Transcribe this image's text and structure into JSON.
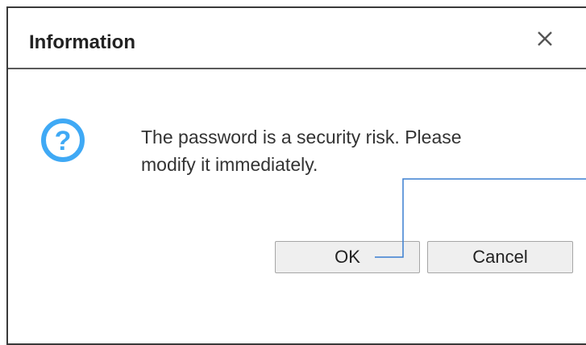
{
  "dialog": {
    "title": "Information",
    "message_line1": "The password is a security risk. Please",
    "message_line2": "modify it immediately.",
    "ok_label": "OK",
    "cancel_label": "Cancel"
  },
  "icons": {
    "dialog_icon": "question-circle-icon",
    "close": "close-icon"
  },
  "colors": {
    "accent": "#3fa9f5",
    "callout_line": "#3a7fd0"
  }
}
